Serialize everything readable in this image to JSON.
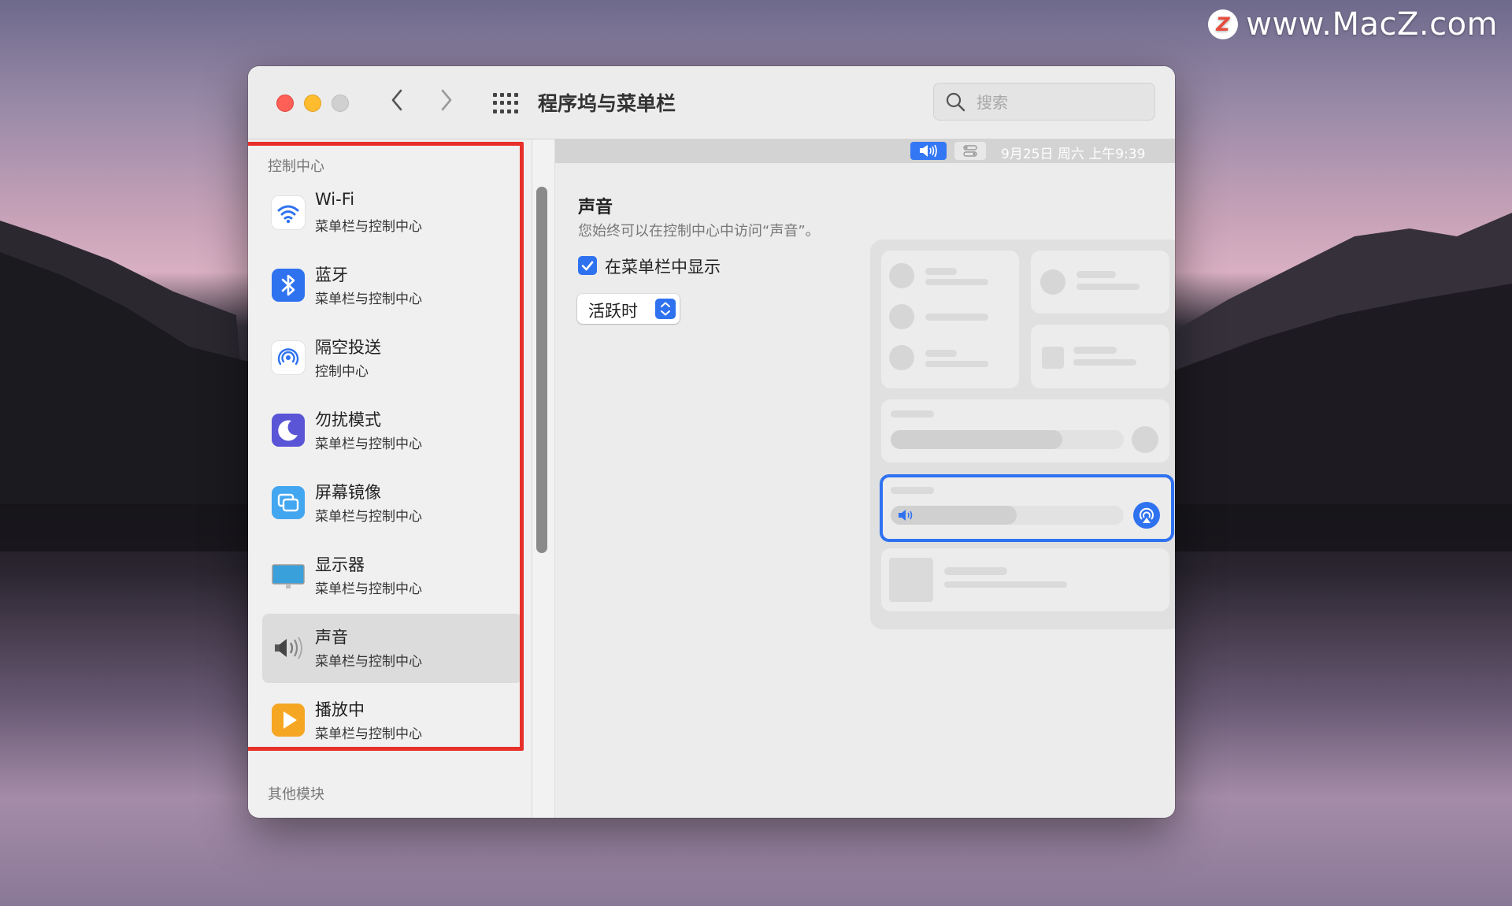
{
  "watermark": {
    "logo_letter": "Z",
    "text": "www.MacZ.com"
  },
  "window": {
    "title": "程序坞与菜单栏",
    "search_placeholder": "搜索"
  },
  "sidebar": {
    "section_control_center": "控制中心",
    "section_other": "其他模块",
    "items": [
      {
        "name": "Wi-Fi",
        "sub": "菜单栏与控制中心",
        "icon": "wifi-icon"
      },
      {
        "name": "蓝牙",
        "sub": "菜单栏与控制中心",
        "icon": "bluetooth-icon"
      },
      {
        "name": "隔空投送",
        "sub": "控制中心",
        "icon": "airdrop-icon"
      },
      {
        "name": "勿扰模式",
        "sub": "菜单栏与控制中心",
        "icon": "moon-icon"
      },
      {
        "name": "屏幕镜像",
        "sub": "菜单栏与控制中心",
        "icon": "screen-mirroring-icon"
      },
      {
        "name": "显示器",
        "sub": "菜单栏与控制中心",
        "icon": "display-icon"
      },
      {
        "name": "声音",
        "sub": "菜单栏与控制中心",
        "icon": "speaker-icon",
        "selected": true
      },
      {
        "name": "播放中",
        "sub": "菜单栏与控制中心",
        "icon": "play-icon"
      }
    ]
  },
  "main": {
    "menubar_date": "9月25日 周六 上午9:39",
    "section_title": "声音",
    "section_desc": "您始终可以在控制中心中访问“声音”。",
    "show_in_menubar_label": "在菜单栏中显示",
    "show_in_menubar_checked": true,
    "show_mode_value": "活跃时",
    "help_label": "?"
  },
  "colors": {
    "accent": "#2f72f0",
    "highlight": "#e8302a"
  }
}
